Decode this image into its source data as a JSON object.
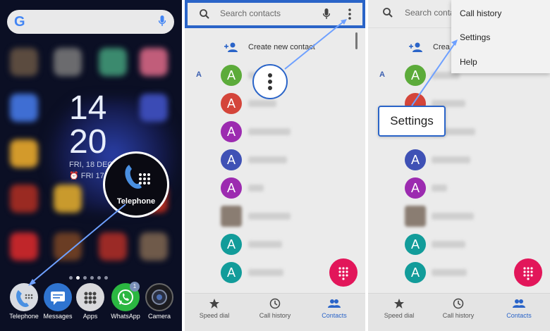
{
  "home": {
    "clock_hours": "14",
    "clock_minutes": "20",
    "date_line": "FRI, 18 DEC",
    "alarm_line": "FRI 17",
    "highlight_label": "Telephone",
    "dock": [
      {
        "label": "Telephone",
        "icon": "phone-icon"
      },
      {
        "label": "Messages",
        "icon": "messages-icon"
      },
      {
        "label": "Apps",
        "icon": "apps-grid-icon"
      },
      {
        "label": "WhatsApp",
        "icon": "whatsapp-icon",
        "badge": "1"
      },
      {
        "label": "Camera",
        "icon": "camera-icon"
      }
    ]
  },
  "contacts": {
    "search_placeholder": "Search contacts",
    "search_placeholder_truncated": "Search conta",
    "create_label": "Create new contact",
    "create_label_truncated": "Crea",
    "section_letter": "A",
    "avatar_letter": "A",
    "menu": [
      "Call history",
      "Settings",
      "Help"
    ],
    "callout": "Settings",
    "nav": [
      {
        "label": "Speed dial",
        "icon": "star-icon"
      },
      {
        "label": "Call history",
        "icon": "clock-icon"
      },
      {
        "label": "Contacts",
        "icon": "people-icon",
        "active": true
      }
    ]
  },
  "colors": {
    "accent": "#2a64c8",
    "fab": "#e2165a",
    "avatar_green": "#5cab3a",
    "avatar_red": "#d4453a",
    "avatar_purple": "#9c2bb0",
    "avatar_indigo": "#3f51b5",
    "avatar_teal": "#129c9a"
  }
}
